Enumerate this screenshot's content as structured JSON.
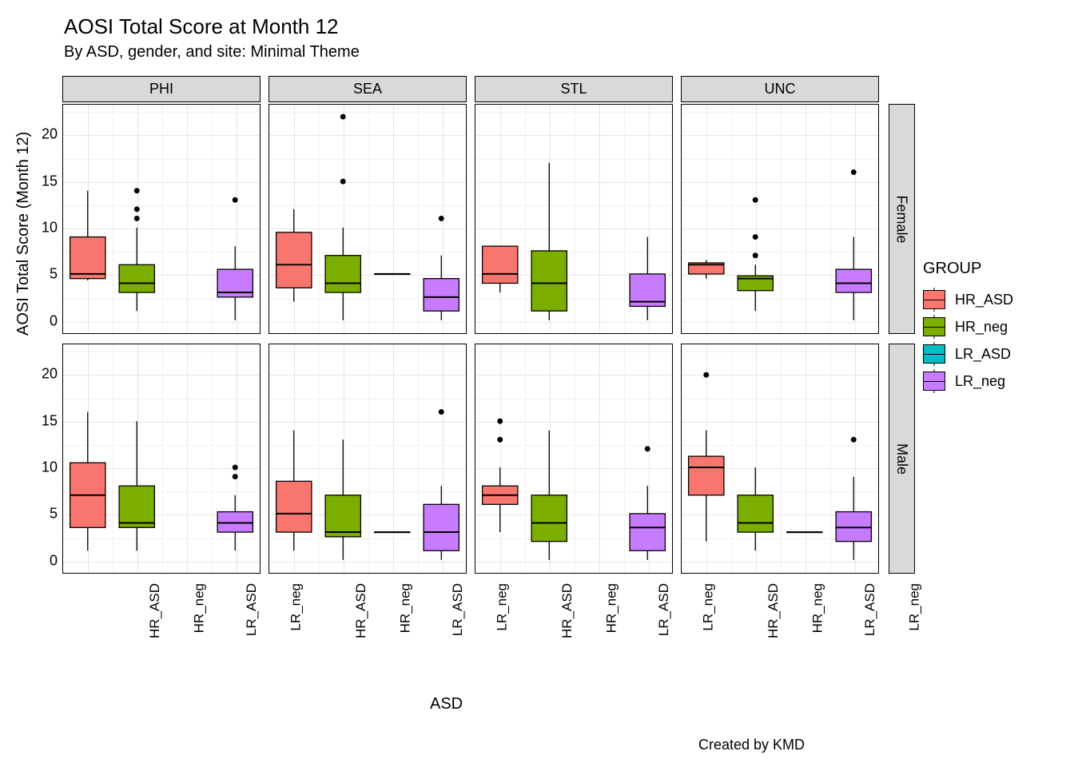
{
  "title": "AOSI Total Score at Month 12",
  "subtitle": "By ASD, gender, and site: Minimal Theme",
  "caption": "Created by KMD",
  "yaxis_title": "AOSI Total Score (Month 12)",
  "xaxis_title": "ASD",
  "legend": {
    "title": "GROUP",
    "items": [
      {
        "name": "HR_ASD",
        "color": "#F8766D"
      },
      {
        "name": "HR_neg",
        "color": "#7CAE00"
      },
      {
        "name": "LR_ASD",
        "color": "#00BFC4"
      },
      {
        "name": "LR_neg",
        "color": "#C77CFF"
      }
    ]
  },
  "facets_col": [
    "PHI",
    "SEA",
    "STL",
    "UNC"
  ],
  "facets_row": [
    "Female",
    "Male"
  ],
  "x_categories": [
    "HR_ASD",
    "HR_neg",
    "LR_ASD",
    "LR_neg"
  ],
  "y_ticks": [
    0,
    5,
    10,
    15,
    20
  ],
  "y_range": [
    -1.4,
    23.3
  ],
  "chart_data": {
    "type": "boxplot-facet-grid",
    "x": [
      "HR_ASD",
      "HR_neg",
      "LR_ASD",
      "LR_neg"
    ],
    "y_axis": "AOSI Total Score (Month 12)",
    "ylim": [
      -1.4,
      23.3
    ],
    "facet_cols": [
      "PHI",
      "SEA",
      "STL",
      "UNC"
    ],
    "facet_rows": [
      "Female",
      "Male"
    ],
    "colors": {
      "HR_ASD": "#F8766D",
      "HR_neg": "#7CAE00",
      "LR_ASD": "#00BFC4",
      "LR_neg": "#C77CFF"
    },
    "panels": {
      "PHI|Female": {
        "HR_ASD": {
          "min": 4.3,
          "q1": 4.5,
          "median": 5.0,
          "q3": 9.0,
          "max": 14.0,
          "outliers": []
        },
        "HR_neg": {
          "min": 1.0,
          "q1": 3.0,
          "median": 4.0,
          "q3": 6.0,
          "max": 10.0,
          "outliers": [
            11,
            12,
            14
          ]
        },
        "LR_ASD": null,
        "LR_neg": {
          "min": 0.0,
          "q1": 2.5,
          "median": 3.0,
          "q3": 5.5,
          "max": 8.0,
          "outliers": [
            13
          ]
        }
      },
      "SEA|Female": {
        "HR_ASD": {
          "min": 2.0,
          "q1": 3.5,
          "median": 6.0,
          "q3": 9.5,
          "max": 12.0,
          "outliers": []
        },
        "HR_neg": {
          "min": 0.0,
          "q1": 3.0,
          "median": 4.0,
          "q3": 7.0,
          "max": 10.0,
          "outliers": [
            15,
            22
          ]
        },
        "LR_ASD": {
          "min": 5.0,
          "q1": 5.0,
          "median": 5.0,
          "q3": 5.0,
          "max": 5.0,
          "outliers": []
        },
        "LR_neg": {
          "min": 0.0,
          "q1": 1.0,
          "median": 2.5,
          "q3": 4.5,
          "max": 7.0,
          "outliers": [
            11
          ]
        }
      },
      "STL|Female": {
        "HR_ASD": {
          "min": 3.0,
          "q1": 4.0,
          "median": 5.0,
          "q3": 8.0,
          "max": 8.0,
          "outliers": []
        },
        "HR_neg": {
          "min": 0.0,
          "q1": 1.0,
          "median": 4.0,
          "q3": 7.5,
          "max": 17.0,
          "outliers": []
        },
        "LR_ASD": null,
        "LR_neg": {
          "min": 0.0,
          "q1": 1.5,
          "median": 2.0,
          "q3": 5.0,
          "max": 9.0,
          "outliers": []
        }
      },
      "UNC|Female": {
        "HR_ASD": {
          "min": 4.5,
          "q1": 5.0,
          "median": 6.0,
          "q3": 6.2,
          "max": 6.5,
          "outliers": []
        },
        "HR_neg": {
          "min": 1.0,
          "q1": 3.2,
          "median": 4.5,
          "q3": 4.8,
          "max": 6.0,
          "outliers": [
            7,
            9,
            13
          ]
        },
        "LR_ASD": null,
        "LR_neg": {
          "min": 0.0,
          "q1": 3.0,
          "median": 4.0,
          "q3": 5.5,
          "max": 9.0,
          "outliers": [
            16
          ]
        }
      },
      "PHI|Male": {
        "HR_ASD": {
          "min": 1.0,
          "q1": 3.5,
          "median": 7.0,
          "q3": 10.5,
          "max": 16.0,
          "outliers": []
        },
        "HR_neg": {
          "min": 1.0,
          "q1": 3.5,
          "median": 4.0,
          "q3": 8.0,
          "max": 15.0,
          "outliers": []
        },
        "LR_ASD": null,
        "LR_neg": {
          "min": 1.0,
          "q1": 3.0,
          "median": 4.0,
          "q3": 5.2,
          "max": 7.0,
          "outliers": [
            9,
            10
          ]
        }
      },
      "SEA|Male": {
        "HR_ASD": {
          "min": 1.0,
          "q1": 3.0,
          "median": 5.0,
          "q3": 8.5,
          "max": 14.0,
          "outliers": []
        },
        "HR_neg": {
          "min": 0.0,
          "q1": 2.5,
          "median": 3.0,
          "q3": 7.0,
          "max": 13.0,
          "outliers": []
        },
        "LR_ASD": {
          "min": 3.0,
          "q1": 3.0,
          "median": 3.0,
          "q3": 3.0,
          "max": 3.0,
          "outliers": []
        },
        "LR_neg": {
          "min": 0.0,
          "q1": 1.0,
          "median": 3.0,
          "q3": 6.0,
          "max": 8.0,
          "outliers": [
            16
          ]
        }
      },
      "STL|Male": {
        "HR_ASD": {
          "min": 3.0,
          "q1": 6.0,
          "median": 7.0,
          "q3": 8.0,
          "max": 10.0,
          "outliers": [
            13,
            15
          ]
        },
        "HR_neg": {
          "min": 0.0,
          "q1": 2.0,
          "median": 4.0,
          "q3": 7.0,
          "max": 14.0,
          "outliers": []
        },
        "LR_ASD": null,
        "LR_neg": {
          "min": 0.0,
          "q1": 1.0,
          "median": 3.5,
          "q3": 5.0,
          "max": 8.0,
          "outliers": [
            12
          ]
        }
      },
      "UNC|Male": {
        "HR_ASD": {
          "min": 2.0,
          "q1": 7.0,
          "median": 10.0,
          "q3": 11.2,
          "max": 14.0,
          "outliers": [
            20
          ]
        },
        "HR_neg": {
          "min": 1.0,
          "q1": 3.0,
          "median": 4.0,
          "q3": 7.0,
          "max": 10.0,
          "outliers": []
        },
        "LR_ASD": {
          "min": 3.0,
          "q1": 3.0,
          "median": 3.0,
          "q3": 3.0,
          "max": 3.0,
          "outliers": []
        },
        "LR_neg": {
          "min": 0.0,
          "q1": 2.0,
          "median": 3.5,
          "q3": 5.2,
          "max": 9.0,
          "outliers": [
            13
          ]
        }
      }
    }
  }
}
